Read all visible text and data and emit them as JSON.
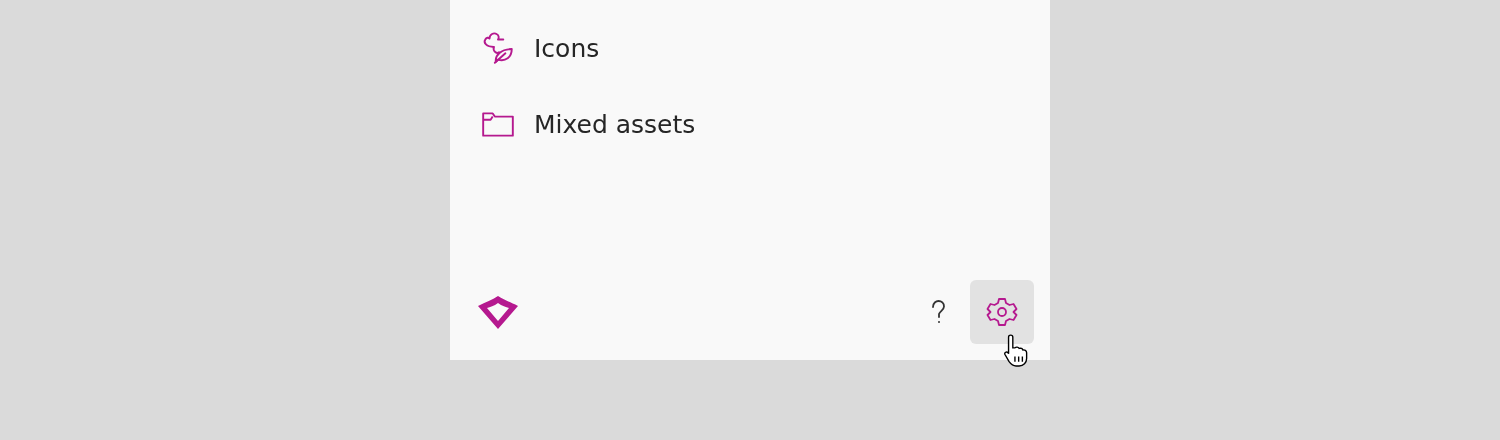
{
  "nav_items": [
    {
      "kind": "icons",
      "label": "Icons"
    },
    {
      "kind": "folder",
      "label": "Mixed assets"
    }
  ],
  "footer": {
    "buttons": [
      {
        "kind": "help",
        "hovered": false
      },
      {
        "kind": "settings",
        "hovered": true
      }
    ]
  }
}
